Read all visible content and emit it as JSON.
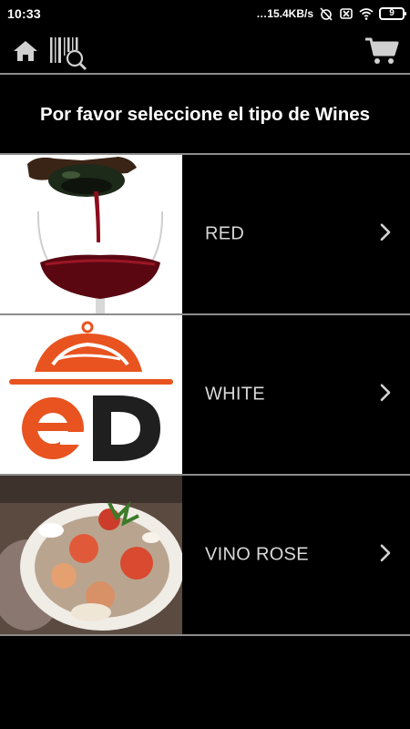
{
  "status_bar": {
    "time": "10:33",
    "net_speed": "15.4KB/s",
    "battery": "9"
  },
  "toolbar": {
    "home_icon": "home-icon",
    "scan_icon": "barcode-search-icon",
    "cart_icon": "cart-icon"
  },
  "header": {
    "title": "Por favor seleccione el tipo de Wines"
  },
  "items": [
    {
      "label": "RED",
      "image": "red-wine-pour-image"
    },
    {
      "label": "WHITE",
      "image": "ed-logo-image"
    },
    {
      "label": "VINO ROSE",
      "image": "ceviche-dish-image"
    }
  ],
  "colors": {
    "background": "#000000",
    "divider": "#8c8c8c",
    "label": "#d9d9d9",
    "logo_orange": "#e8531f",
    "logo_dark": "#1f1f1f"
  }
}
